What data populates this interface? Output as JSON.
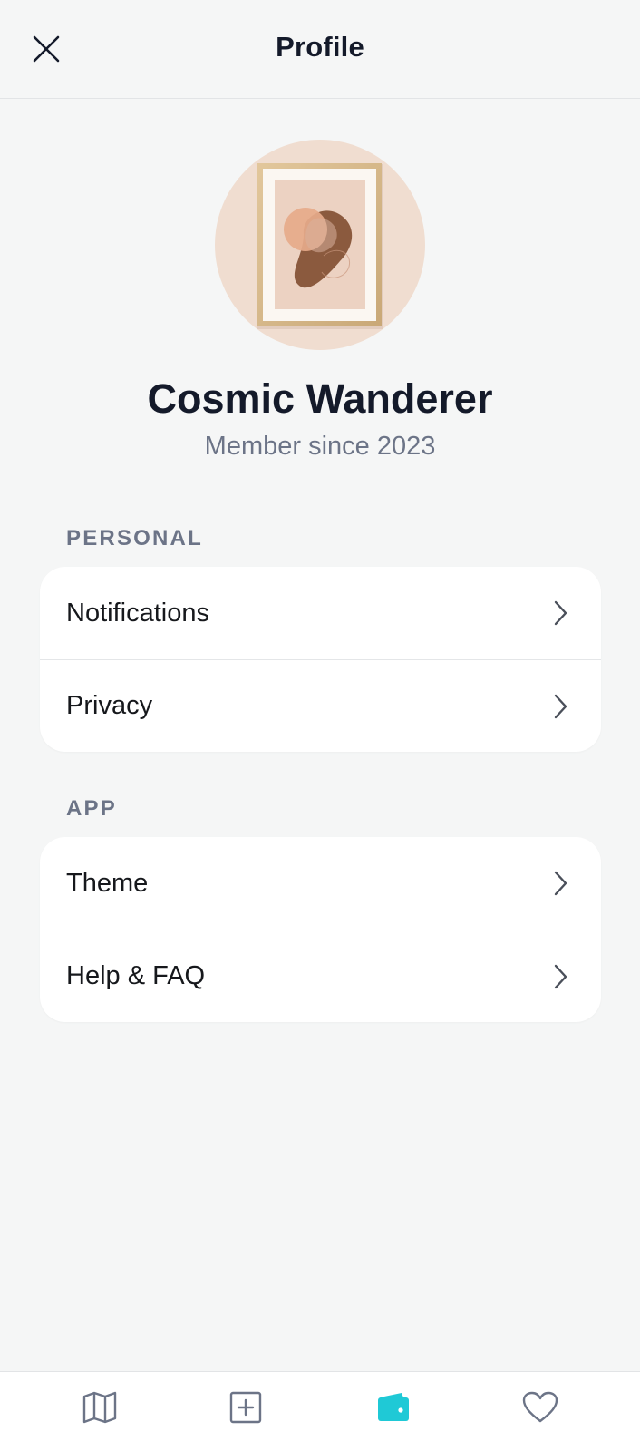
{
  "header": {
    "title": "Profile",
    "close_icon": "close-icon"
  },
  "profile": {
    "name": "Cosmic Wanderer",
    "member_since": "Member since 2023",
    "avatar_icon": "framed-abstract-art"
  },
  "sections": [
    {
      "label": "PERSONAL",
      "items": [
        {
          "label": "Notifications",
          "icon": "chevron-right-icon"
        },
        {
          "label": "Privacy",
          "icon": "chevron-right-icon"
        }
      ]
    },
    {
      "label": "APP",
      "items": [
        {
          "label": "Theme",
          "icon": "chevron-right-icon"
        },
        {
          "label": "Help & FAQ",
          "icon": "chevron-right-icon"
        }
      ]
    }
  ],
  "bottom_nav": {
    "items": [
      {
        "icon": "map-icon",
        "active": false
      },
      {
        "icon": "plus-square-icon",
        "active": false
      },
      {
        "icon": "wallet-icon",
        "active": true
      },
      {
        "icon": "heart-icon",
        "active": false
      }
    ]
  },
  "colors": {
    "accent": "#1fc9d6",
    "text_primary": "#141a2a",
    "text_secondary": "#6c7487",
    "background": "#f5f6f6",
    "card": "#ffffff"
  }
}
